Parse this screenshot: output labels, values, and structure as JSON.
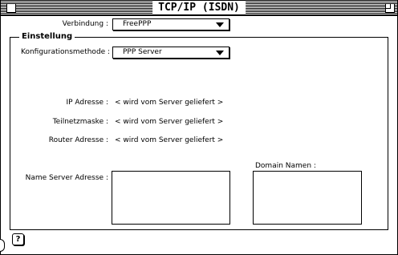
{
  "window": {
    "title": "TCP/IP (ISDN)"
  },
  "connection": {
    "label": "Verbindung :",
    "value": "FreePPP"
  },
  "settings": {
    "group_title": "Einstellung",
    "config_label": "Konfigurationsmethode :",
    "config_value": "PPP Server",
    "ip_label": "IP Adresse :",
    "ip_value": "< wird vom Server geliefert >",
    "subnet_label": "Teilnetzmaske :",
    "subnet_value": "< wird vom Server geliefert >",
    "router_label": "Router Adresse :",
    "router_value": "< wird vom Server geliefert >",
    "nameserver_label": "Name Server Adresse :",
    "domain_label": "Domain Namen :"
  },
  "footer": {
    "help_glyph": "?"
  }
}
